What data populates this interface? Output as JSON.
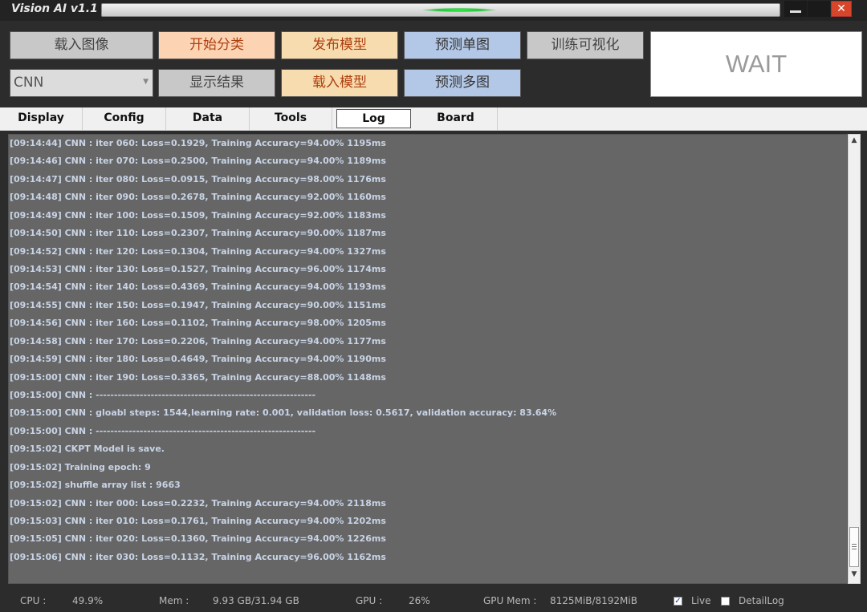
{
  "window": {
    "title": "Vision AI v1.1",
    "close_glyph": "✕"
  },
  "toolbar": {
    "load_image": "载入图像",
    "start_classify": "开始分类",
    "publish_model": "发布模型",
    "predict_single": "预测单图",
    "train_visualize": "训练可视化",
    "model_select": "CNN",
    "show_result": "显示结果",
    "load_model": "载入模型",
    "predict_multi": "预测多图",
    "status": "WAIT"
  },
  "tabs": [
    {
      "label": "Display"
    },
    {
      "label": "Config"
    },
    {
      "label": "Data"
    },
    {
      "label": "Tools"
    },
    {
      "label": "Log",
      "active": true
    },
    {
      "label": "Board"
    }
  ],
  "log": [
    "[09:14:44] CNN : iter 060: Loss=0.1929, Training Accuracy=94.00% 1195ms",
    "[09:14:46] CNN : iter 070: Loss=0.2500, Training Accuracy=94.00% 1189ms",
    "[09:14:47] CNN : iter 080: Loss=0.0915, Training Accuracy=98.00% 1176ms",
    "[09:14:48] CNN : iter 090: Loss=0.2678, Training Accuracy=92.00% 1160ms",
    "[09:14:49] CNN : iter 100: Loss=0.1509, Training Accuracy=92.00% 1183ms",
    "[09:14:50] CNN : iter 110: Loss=0.2307, Training Accuracy=90.00% 1187ms",
    "[09:14:52] CNN : iter 120: Loss=0.1304, Training Accuracy=94.00% 1327ms",
    "[09:14:53] CNN : iter 130: Loss=0.1527, Training Accuracy=96.00% 1174ms",
    "[09:14:54] CNN : iter 140: Loss=0.4369, Training Accuracy=94.00% 1193ms",
    "[09:14:55] CNN : iter 150: Loss=0.1947, Training Accuracy=90.00% 1151ms",
    "[09:14:56] CNN : iter 160: Loss=0.1102, Training Accuracy=98.00% 1205ms",
    "[09:14:58] CNN : iter 170: Loss=0.2206, Training Accuracy=94.00% 1177ms",
    "[09:14:59] CNN : iter 180: Loss=0.4649, Training Accuracy=94.00% 1190ms",
    "[09:15:00] CNN : iter 190: Loss=0.3365, Training Accuracy=88.00% 1148ms",
    "[09:15:00] CNN : ------------------------------------------------------------",
    "[09:15:00] CNN : gloabl steps: 1544,learning rate: 0.001, validation loss: 0.5617, validation accuracy: 83.64%",
    "[09:15:00] CNN : ------------------------------------------------------------",
    "[09:15:02] CKPT Model is save.",
    "[09:15:02] Training epoch: 9",
    "[09:15:02] shuffle array list :  9663",
    "[09:15:02] CNN : iter 000: Loss=0.2232, Training Accuracy=94.00% 2118ms",
    "[09:15:03] CNN : iter 010: Loss=0.1761, Training Accuracy=94.00% 1202ms",
    "[09:15:05] CNN : iter 020: Loss=0.1360, Training Accuracy=94.00% 1226ms",
    "[09:15:06] CNN : iter 030: Loss=0.1132, Training Accuracy=96.00% 1162ms"
  ],
  "status": {
    "cpu_label": "CPU :",
    "cpu_value": "49.9%",
    "mem_label": "Mem :",
    "mem_value": "9.93 GB/31.94 GB",
    "gpu_label": "GPU :",
    "gpu_value": "26%",
    "gpumem_label": "GPU Mem :",
    "gpumem_value": "8125MiB/8192MiB",
    "live_label": "Live",
    "live_checked": true,
    "detail_label": "DetailLog",
    "detail_checked": false
  },
  "colors": {
    "background": "#2c2c2c",
    "log_bg": "#666666",
    "log_text": "#c8d4e6",
    "peach_btn": "#fcd4b4",
    "wheat_btn": "#f6dcae",
    "blue_btn": "#b3c7e6",
    "gray_btn": "#c8c8c8"
  }
}
